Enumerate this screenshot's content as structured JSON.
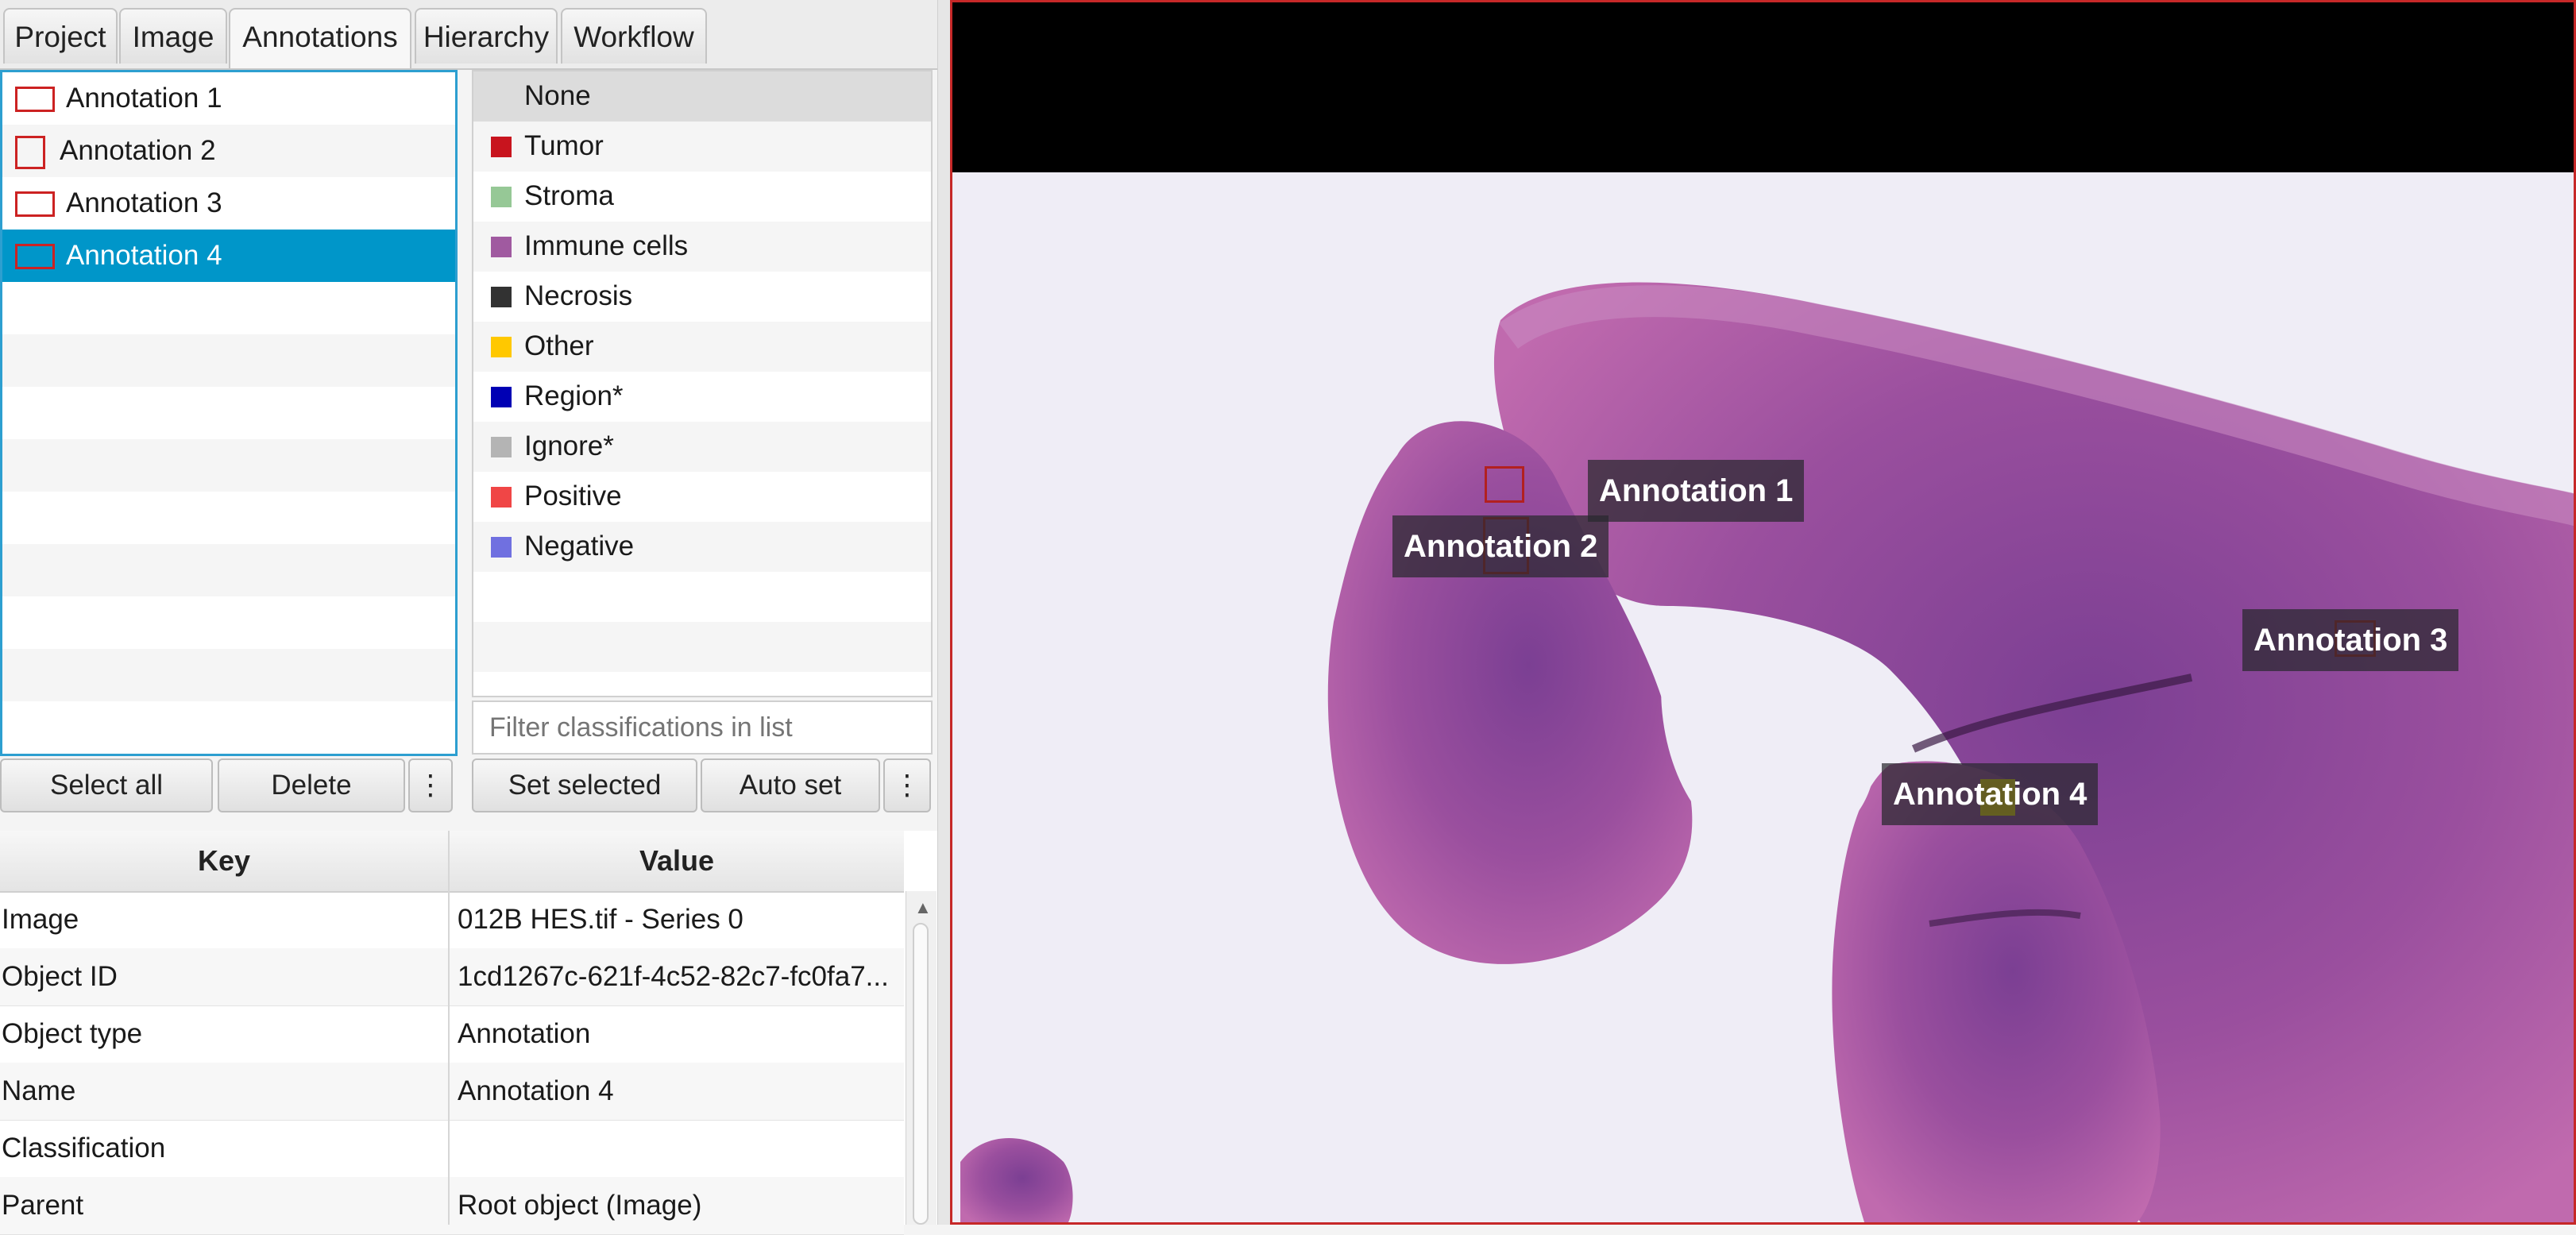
{
  "tabs": [
    "Project",
    "Image",
    "Annotations",
    "Hierarchy",
    "Workflow"
  ],
  "annotations": [
    {
      "label": "Annotation 1",
      "selected": false
    },
    {
      "label": "Annotation 2",
      "selected": false
    },
    {
      "label": "Annotation 3",
      "selected": false
    },
    {
      "label": "Annotation 4",
      "selected": true
    }
  ],
  "classifications": [
    {
      "label": "None",
      "color": ""
    },
    {
      "label": "Tumor",
      "color": "#c8141e"
    },
    {
      "label": "Stroma",
      "color": "#96c896"
    },
    {
      "label": "Immune cells",
      "color": "#a05aa0"
    },
    {
      "label": "Necrosis",
      "color": "#323232"
    },
    {
      "label": "Other",
      "color": "#ffc800"
    },
    {
      "label": "Region*",
      "color": "#0000b4"
    },
    {
      "label": "Ignore*",
      "color": "#b4b4b4"
    },
    {
      "label": "Positive",
      "color": "#f04646"
    },
    {
      "label": "Negative",
      "color": "#7070e0"
    }
  ],
  "class_filter": {
    "placeholder": "Filter classifications in list"
  },
  "buttons": {
    "select_all": "Select all",
    "delete": "Delete",
    "more": "⋮",
    "set_selected": "Set selected",
    "auto_set": "Auto set"
  },
  "properties": {
    "headers": {
      "key": "Key",
      "value": "Value"
    },
    "rows": [
      {
        "key": "Image",
        "value": "012B HES.tif - Series 0"
      },
      {
        "key": "Object ID",
        "value": "1cd1267c-621f-4c52-82c7-fc0fa7..."
      },
      {
        "key": "Object type",
        "value": "Annotation"
      },
      {
        "key": "Name",
        "value": "Annotation 4"
      },
      {
        "key": "Classification",
        "value": ""
      },
      {
        "key": "Parent",
        "value": "Root object (Image)"
      }
    ]
  },
  "viewer": {
    "labels": [
      "Annotation 1",
      "Annotation 2",
      "Annotation 3",
      "Annotation 4"
    ],
    "border_color": "#c62828",
    "selected_color": "#ffe600"
  }
}
